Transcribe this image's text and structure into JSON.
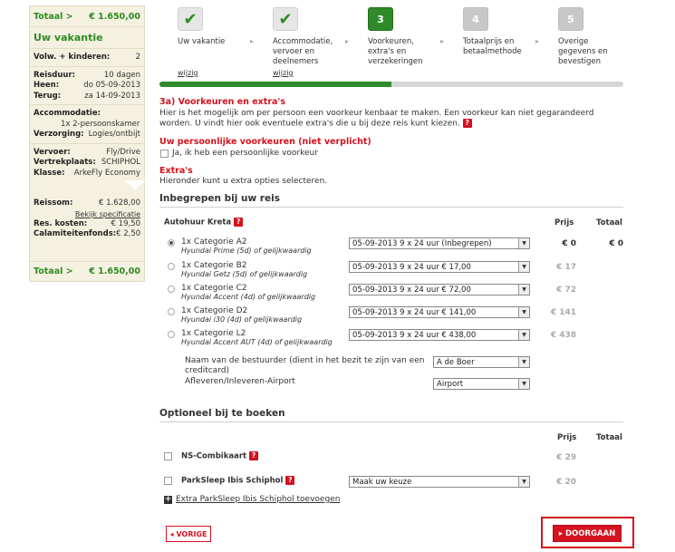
{
  "sidebar": {
    "total_label": "Totaal >",
    "total_value": "€ 1.650,00",
    "title": "Uw vakantie",
    "travellers": {
      "label": "Volw. + kinderen:",
      "value": "2"
    },
    "reisduur": {
      "label": "Reisduur:",
      "value": "10 dagen"
    },
    "heen": {
      "label": "Heen:",
      "value": "do 05-09-2013"
    },
    "terug": {
      "label": "Terug:",
      "value": "za 14-09-2013"
    },
    "accommodatie": {
      "label": "Accommodatie:",
      "value": "1x 2-persoonskamer"
    },
    "verzorging": {
      "label": "Verzorging:",
      "value": "Logies/ontbijt"
    },
    "vervoer": {
      "label": "Vervoer:",
      "value": "Fly/Drive"
    },
    "vertrekplaats": {
      "label": "Vertrekplaats:",
      "value": "SCHIPHOL"
    },
    "klasse": {
      "label": "Klasse:",
      "value": "ArkeFly Economy"
    },
    "reissom": {
      "label": "Reissom:",
      "value": "€ 1.628,00"
    },
    "specificatie_link": "Bekijk specificatie",
    "res_kosten": {
      "label": "Res. kosten:",
      "value": "€ 19,50"
    },
    "calamiteitenfonds": {
      "label": "Calamiteitenfonds:",
      "value": "€ 2,50"
    },
    "footer_label": "Totaal >",
    "footer_value": "€ 1.650,00"
  },
  "steps": [
    {
      "number": "1",
      "icon": "check-icon",
      "state": "done",
      "line1": "Uw vakantie",
      "line2": "",
      "line3": "",
      "link": "wijzig"
    },
    {
      "number": "2",
      "icon": "check-icon",
      "state": "done",
      "line1": "Accommodatie,",
      "line2": "vervoer en",
      "line3": "deelnemers",
      "link": "wijzig"
    },
    {
      "number": "3",
      "icon": "",
      "state": "active",
      "line1": "Voorkeuren,",
      "line2": "extra's en",
      "line3": "verzekeringen",
      "link": ""
    },
    {
      "number": "4",
      "icon": "",
      "state": "future",
      "line1": "Totaalprijs en",
      "line2": "betaalmethode",
      "line3": "",
      "link": ""
    },
    {
      "number": "5",
      "icon": "",
      "state": "future",
      "line1": "Overige",
      "line2": "gegevens en",
      "line3": "bevestigen",
      "link": ""
    }
  ],
  "progress": {
    "fraction": 0.5
  },
  "intro": {
    "title": "3a) Voorkeuren en extra's",
    "text1": "Hier is het mogelijk om per persoon een voorkeur kenbaar te maken. Een voorkeur kan niet gegarandeerd",
    "text2": "worden. U vindt hier ook eventuele extra's die u bij deze reis kunt kiezen.",
    "help": "?"
  },
  "preferences": {
    "title": "Uw persoonlijke voorkeuren (niet verplicht)",
    "checkbox_label": "Ja, ik heb een persoonlijke voorkeur"
  },
  "extras": {
    "title": "Extra's",
    "text": "Hieronder kunt u extra opties selecteren."
  },
  "included": {
    "title": "Inbegrepen bij uw reis",
    "group_title": "Autohuur Kreta",
    "help": "?",
    "col_prijs": "Prijs",
    "col_totaal": "Totaal",
    "cars": [
      {
        "name": "1x Categorie A2",
        "model": "Hyundai Prime (5d) of gelijkwaardig",
        "option": "05-09-2013 9 x 24 uur (Inbegrepen)",
        "price": "€ 0",
        "total": "€ 0",
        "selected": true
      },
      {
        "name": "1x Categorie B2",
        "model": "Hyundai Getz (5d) of gelijkwaardig",
        "option": "05-09-2013 9 x 24 uur € 17,00",
        "price": "€ 17",
        "total": "",
        "selected": false
      },
      {
        "name": "1x Categorie C2",
        "model": "Hyundai Accent (4d) of gelijkwaardig",
        "option": "05-09-2013 9 x 24 uur € 72,00",
        "price": "€ 72",
        "total": "",
        "selected": false
      },
      {
        "name": "1x Categorie D2",
        "model": "Hyundai i30 (4d) of gelijkwaardig",
        "option": "05-09-2013 9 x 24 uur € 141,00",
        "price": "€ 141",
        "total": "",
        "selected": false
      },
      {
        "name": "1x Categorie L2",
        "model": "Hyundai Accent AUT (4d) of gelijkwaardig",
        "option": "05-09-2013 9 x 24 uur € 438,00",
        "price": "€ 438",
        "total": "",
        "selected": false
      }
    ],
    "driver_label_1": "Naam van de bestuurder (dient in het bezit te zijn van een",
    "driver_label_2": "creditcard)",
    "driver_value": "A de Boer",
    "dropoff_label": "Afleveren/Inleveren-Airport",
    "dropoff_value": "Airport"
  },
  "optional": {
    "title": "Optioneel bij te boeken",
    "col_prijs": "Prijs",
    "col_totaal": "Totaal",
    "items": [
      {
        "name": "NS-Combikaart",
        "help": "?",
        "price": "€ 29"
      },
      {
        "name": "ParkSleep Ibis Schiphol",
        "help": "?",
        "price": "€ 20",
        "select": "Maak uw keuze"
      }
    ],
    "add_link": "Extra ParkSleep Ibis Schiphol toevoegen",
    "add_icon": "+"
  },
  "buttons": {
    "prev": "VORIGE",
    "prev_icon": "◂",
    "next": "DOORGAAN",
    "next_icon": "▸"
  },
  "colors": {
    "accent": "#d5121f",
    "green": "#2f8a2a",
    "sidebar_bg": "#f5f1e1"
  }
}
